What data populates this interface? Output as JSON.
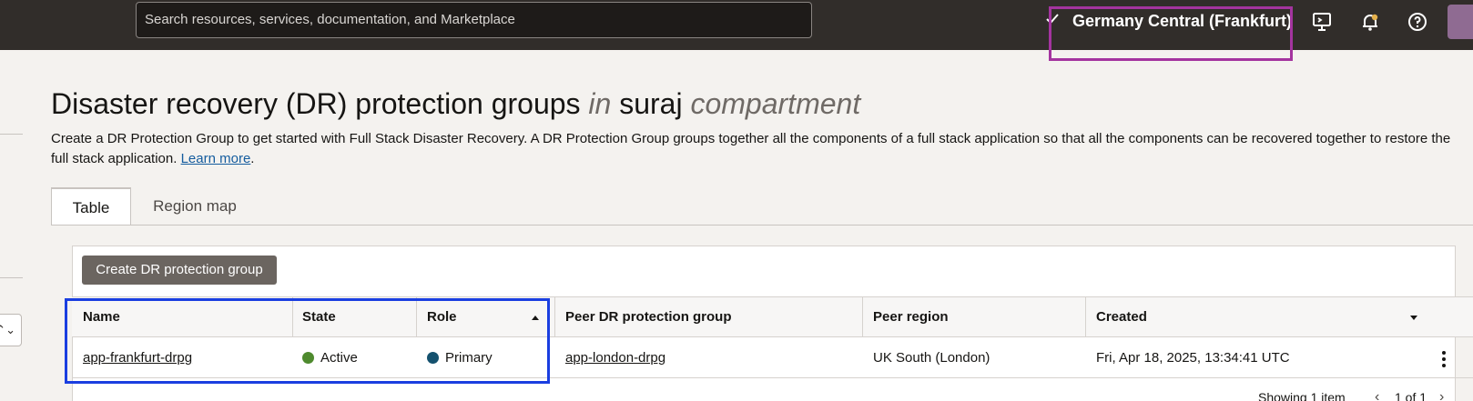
{
  "header": {
    "search_placeholder": "Search resources, services, documentation, and Marketplace",
    "region": "Germany Central (Frankfurt)",
    "icons": [
      "cloud-shell-icon",
      "bell-icon",
      "help-icon",
      "avatar"
    ],
    "colors": {
      "topbar": "#312d2a",
      "region_highlight": "#a4349f"
    }
  },
  "page": {
    "title_main": "Disaster recovery (DR) protection groups",
    "title_in": "in",
    "title_compartment_name": "suraj",
    "title_compartment_word": "compartment",
    "description": "Create a DR Protection Group to get started with Full Stack Disaster Recovery. A DR Protection Group groups together all the components of a full stack application so that all the components can be recovered together to restore the full stack application.",
    "learn_more": "Learn more",
    "description_end": "."
  },
  "tabs": [
    {
      "label": "Table",
      "active": true
    },
    {
      "label": "Region map",
      "active": false
    }
  ],
  "table": {
    "create_button": "Create DR protection group",
    "columns": [
      "Name",
      "State",
      "Role",
      "Peer DR protection group",
      "Peer region",
      "Created"
    ],
    "rows": [
      {
        "name": "app-frankfurt-drpg",
        "state": "Active",
        "role": "Primary",
        "peer_group": "app-london-drpg",
        "peer_region": "UK South (London)",
        "created": "Fri, Apr 18, 2025, 13:34:41 UTC"
      }
    ],
    "footer": {
      "showing": "Showing 1 item",
      "page": "1 of 1"
    },
    "colors": {
      "active_dot": "#4e8a2e",
      "primary_dot": "#14516e",
      "highlight": "#1a3ee0"
    }
  }
}
